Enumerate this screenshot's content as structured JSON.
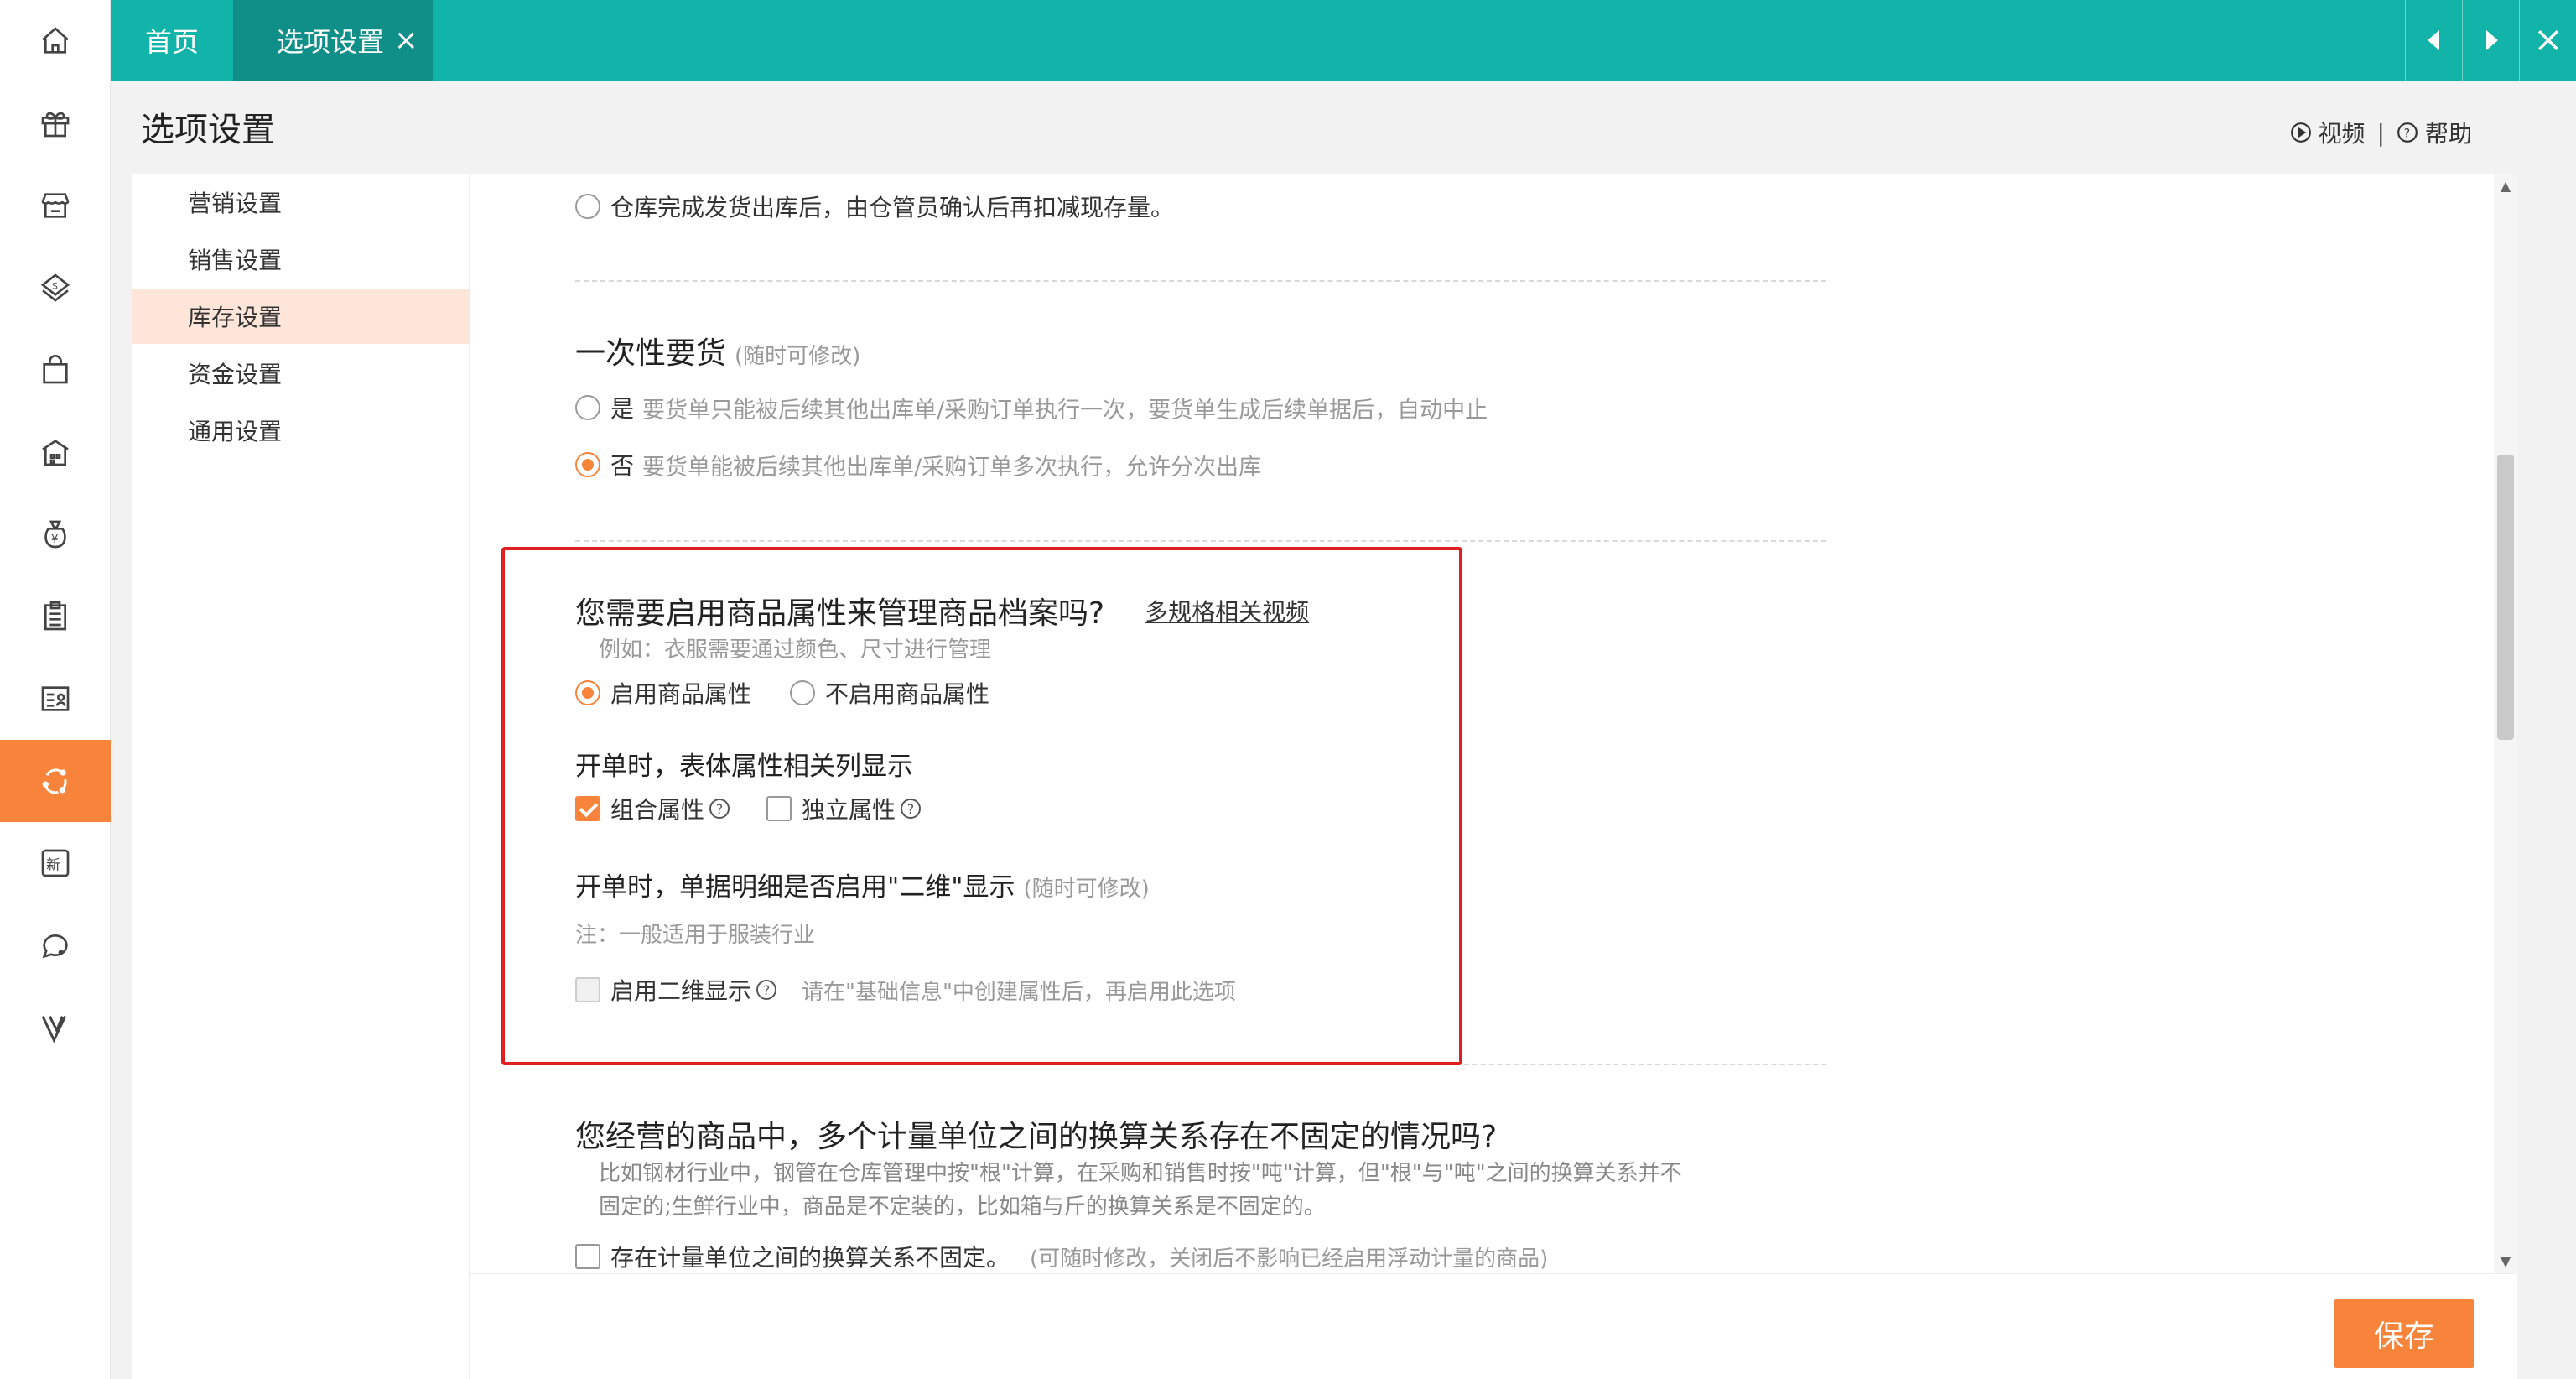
{
  "tabs": {
    "home": "首页",
    "options": "选项设置",
    "close": "×"
  },
  "page": {
    "title": "选项设置",
    "video_link": "视频",
    "separator": "|",
    "help_link": "帮助"
  },
  "rail_icons": [
    "home-icon",
    "gift-icon",
    "store-icon",
    "money-bag-icon",
    "shopping-bag-icon",
    "warehouse-icon",
    "yen-bag-icon",
    "clipboard-icon",
    "id-card-icon",
    "sync-icon",
    "new-badge-icon",
    "chat-icon",
    "v-logo-icon"
  ],
  "active_rail_index": 9,
  "subnav": {
    "items": [
      "营销设置",
      "销售设置",
      "库存设置",
      "资金设置",
      "通用设置"
    ],
    "active": "库存设置"
  },
  "sections": {
    "warehouse_option": {
      "label": "仓库完成发货出库后，由仓管员确认后再扣减现存量。"
    },
    "one_time": {
      "title": "一次性要货",
      "note": "(随时可修改)",
      "yes_label": "是",
      "yes_desc": "要货单只能被后续其他出库单/采购订单执行一次，要货单生成后续单据后，自动中止",
      "no_label": "否",
      "no_desc": "要货单能被后续其他出库单/采购订单多次执行，允许分次出库"
    },
    "attributes": {
      "title": "您需要启用商品属性来管理商品档案吗?",
      "video_link": "多规格相关视频",
      "example": "例如：衣服需要通过颜色、尺寸进行管理",
      "enable_label": "启用商品属性",
      "disable_label": "不启用商品属性",
      "columns_title": "开单时，表体属性相关列显示",
      "combined_label": "组合属性",
      "independent_label": "独立属性",
      "twod_title": "开单时，单据明细是否启用\"二维\"显示",
      "twod_note": "(随时可修改)",
      "twod_hint": "注：一般适用于服装行业",
      "twod_label": "启用二维显示",
      "twod_desc": "请在\"基础信息\"中创建属性后，再启用此选项"
    },
    "units": {
      "title": "您经营的商品中，多个计量单位之间的换算关系存在不固定的情况吗?",
      "desc_line1": "比如钢材行业中，钢管在仓库管理中按\"根\"计算，在采购和销售时按\"吨\"计算，但\"根\"与\"吨\"之间的换算关系并不",
      "desc_line2": "固定的;生鲜行业中，商品是不定装的，比如箱与斤的换算关系是不固定的。",
      "option_label": "存在计量单位之间的换算关系不固定。",
      "option_note": "(可随时修改，关闭后不影响已经启用浮动计量的商品)"
    }
  },
  "footer": {
    "save": "保存"
  },
  "colors": {
    "teal": "#12b3a8",
    "teal_dark": "#0f8f87",
    "orange": "#f7843a",
    "highlight_red": "#e02020"
  }
}
